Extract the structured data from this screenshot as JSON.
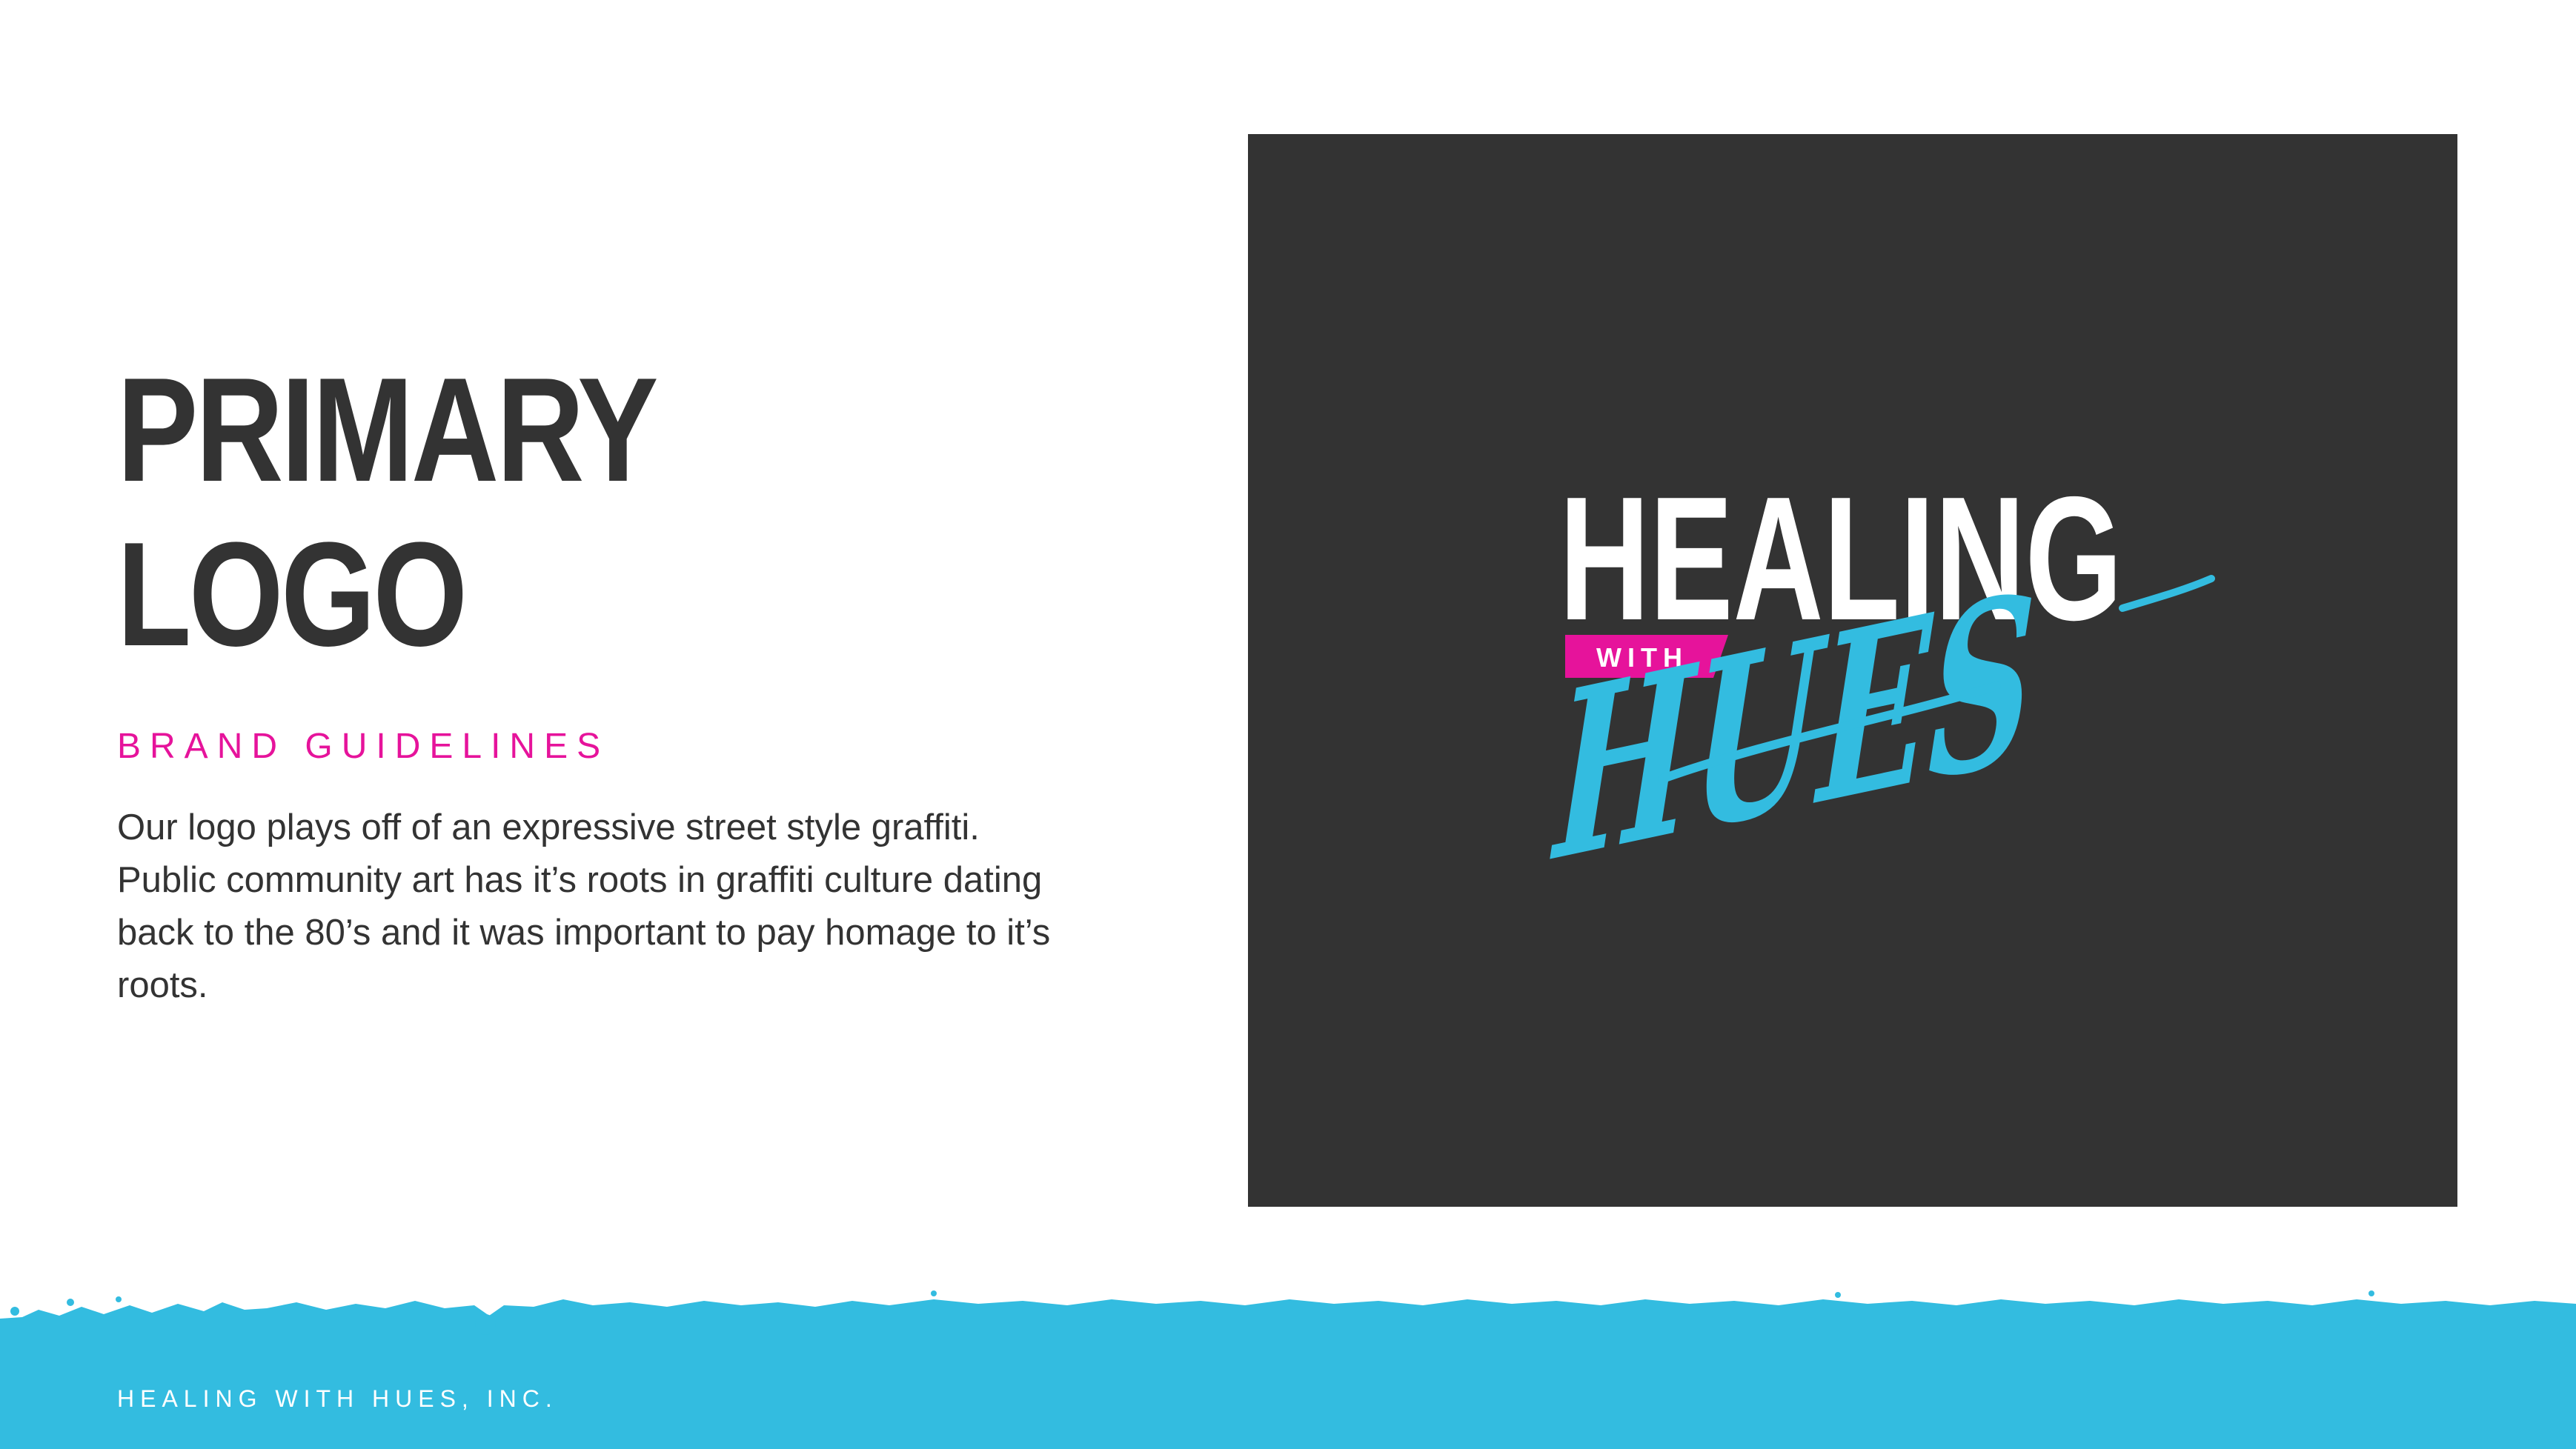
{
  "page": {
    "title_line1": "PRIMARY",
    "title_line2": "LOGO",
    "subtitle": "BRAND GUIDELINES",
    "body": "Our logo plays off of an expressive street style graffiti. Public community art has it’s roots in graffiti culture dating back to the 80’s and it was important to pay homage to it’s roots."
  },
  "logo": {
    "word_main": "HEALING",
    "word_small": "WITH",
    "word_script": "HUES"
  },
  "footer": {
    "text": "HEALING WITH HUES, INC."
  },
  "colors": {
    "dark": "#333333",
    "magenta": "#e6139b",
    "cyan": "#33bce0",
    "white": "#ffffff"
  }
}
